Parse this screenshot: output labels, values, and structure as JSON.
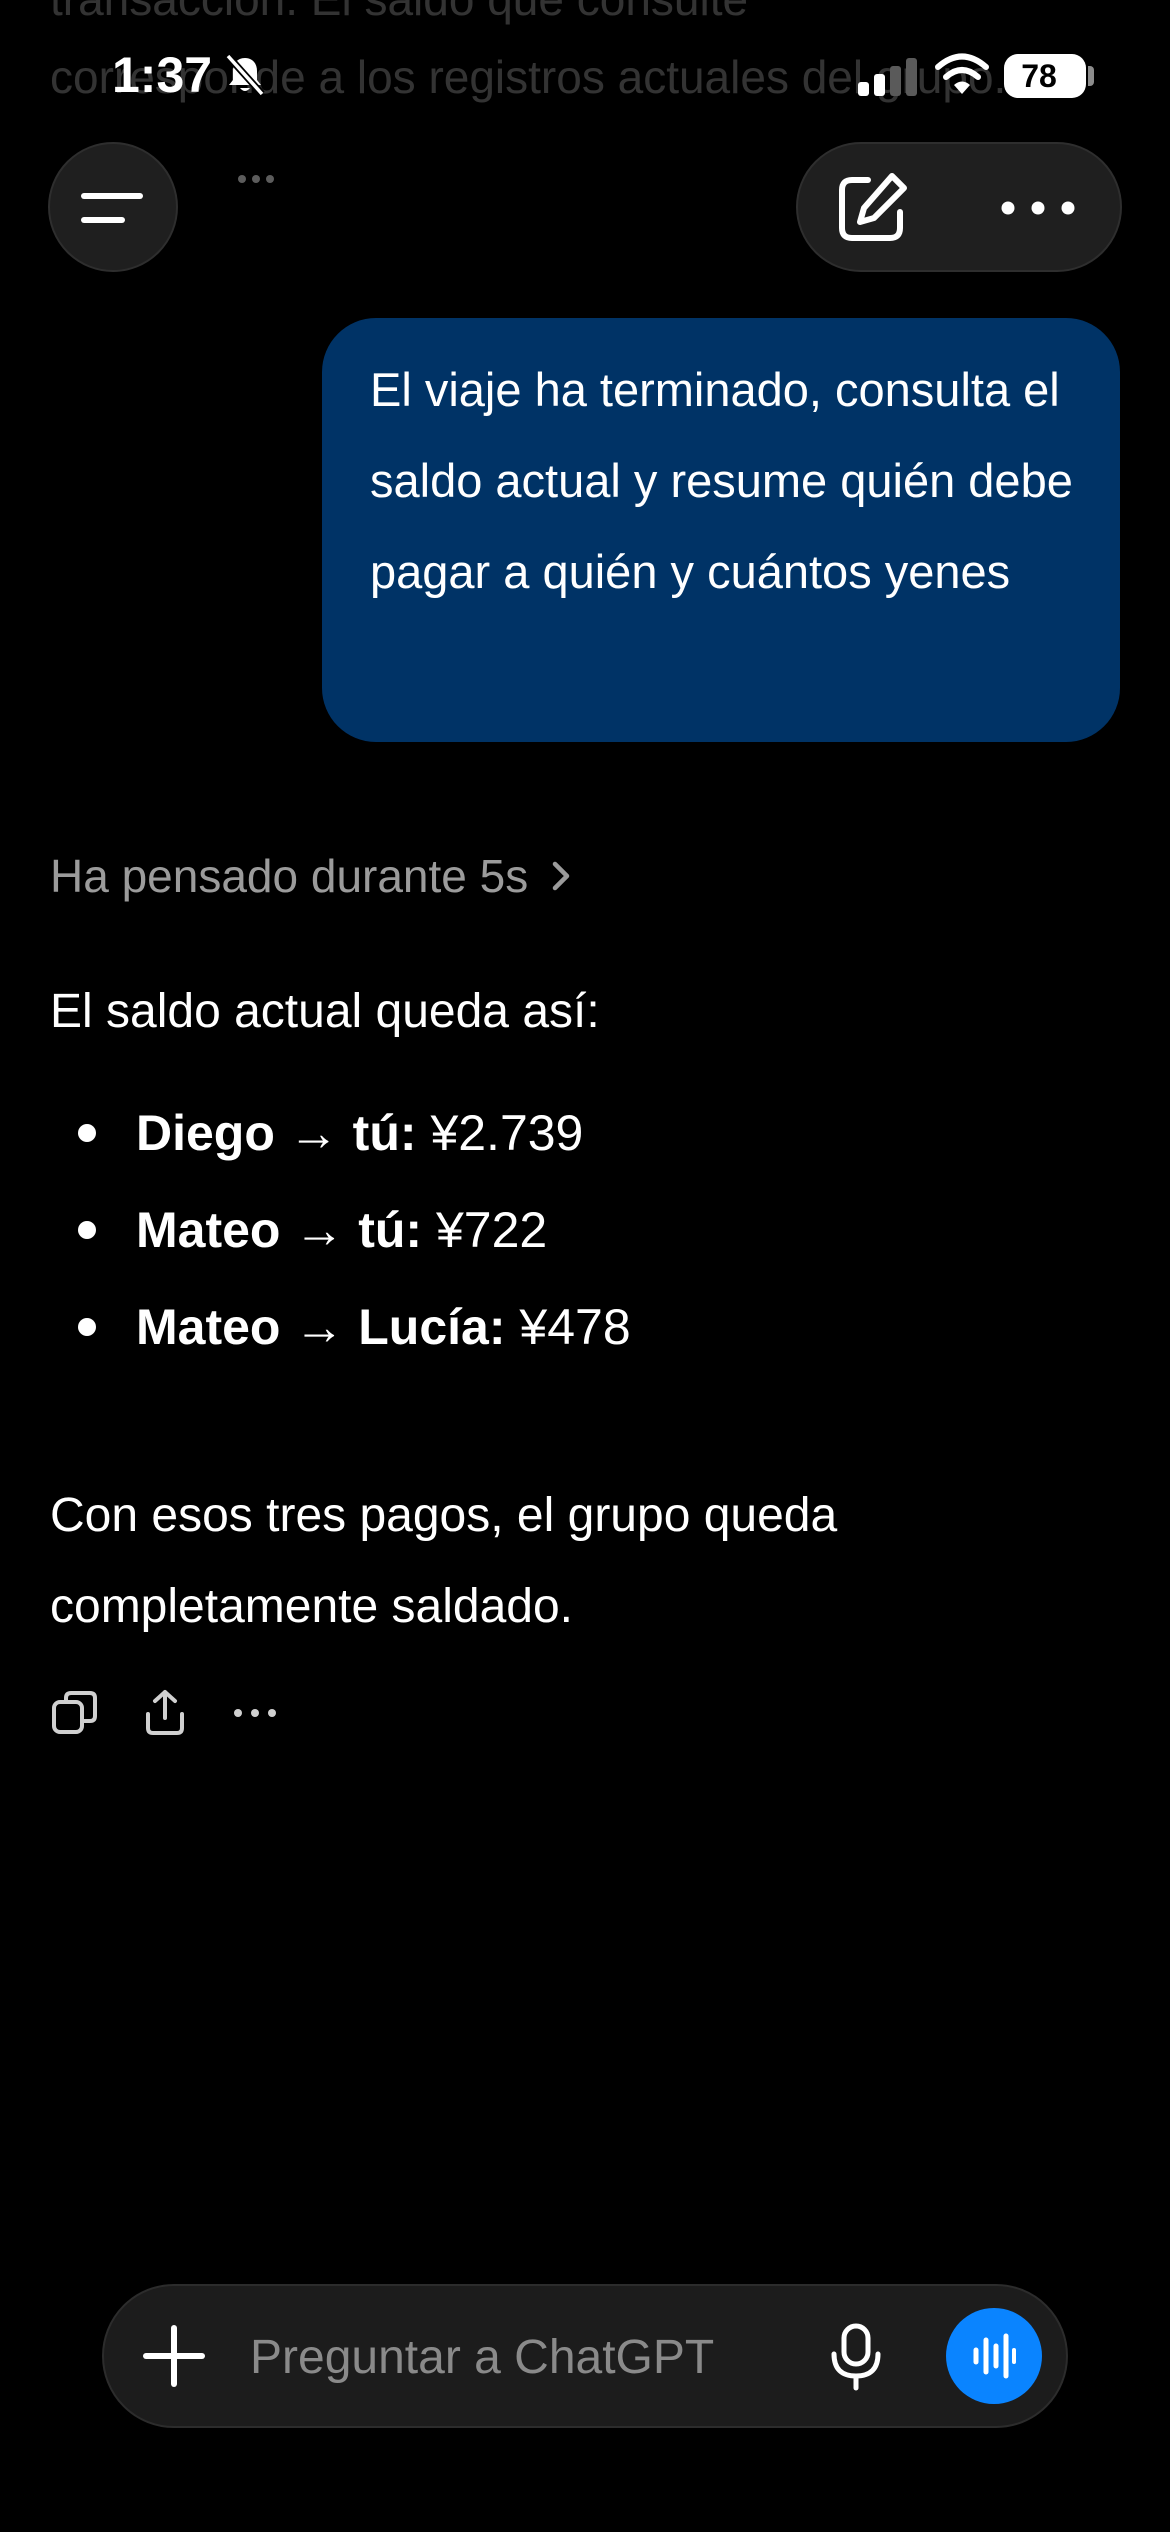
{
  "background_faded": {
    "line1": "transacción. El saldo que consulte",
    "line2": "corresponde a los registros actuales del grupo."
  },
  "status_bar": {
    "time": "1:37",
    "battery": "78"
  },
  "conversation": {
    "user_message": "El viaje ha terminado, consulta el saldo actual y resume quién debe pagar a quién y cuántos yenes",
    "thinking_label": "Ha pensado durante 5s",
    "assistant": {
      "intro": "El saldo actual queda así:",
      "items": [
        {
          "label": "Diego → tú:",
          "amount": "¥2.739"
        },
        {
          "label": "Mateo → tú:",
          "amount": "¥722"
        },
        {
          "label": "Mateo → Lucía:",
          "amount": "¥478"
        }
      ],
      "conclusion": "Con esos tres pagos, el grupo queda completamente saldado."
    }
  },
  "composer": {
    "placeholder": "Preguntar a ChatGPT"
  },
  "colors": {
    "user_bubble": "#003366",
    "voice_button": "#0a84ff",
    "background": "#000000"
  },
  "icons": {
    "menu": "menu-icon",
    "edit": "new-chat-edit-icon",
    "more": "more-dots-icon",
    "copy": "copy-icon",
    "share": "share-icon",
    "plus": "plus-icon",
    "mic": "microphone-icon",
    "voice": "voice-wave-icon"
  }
}
